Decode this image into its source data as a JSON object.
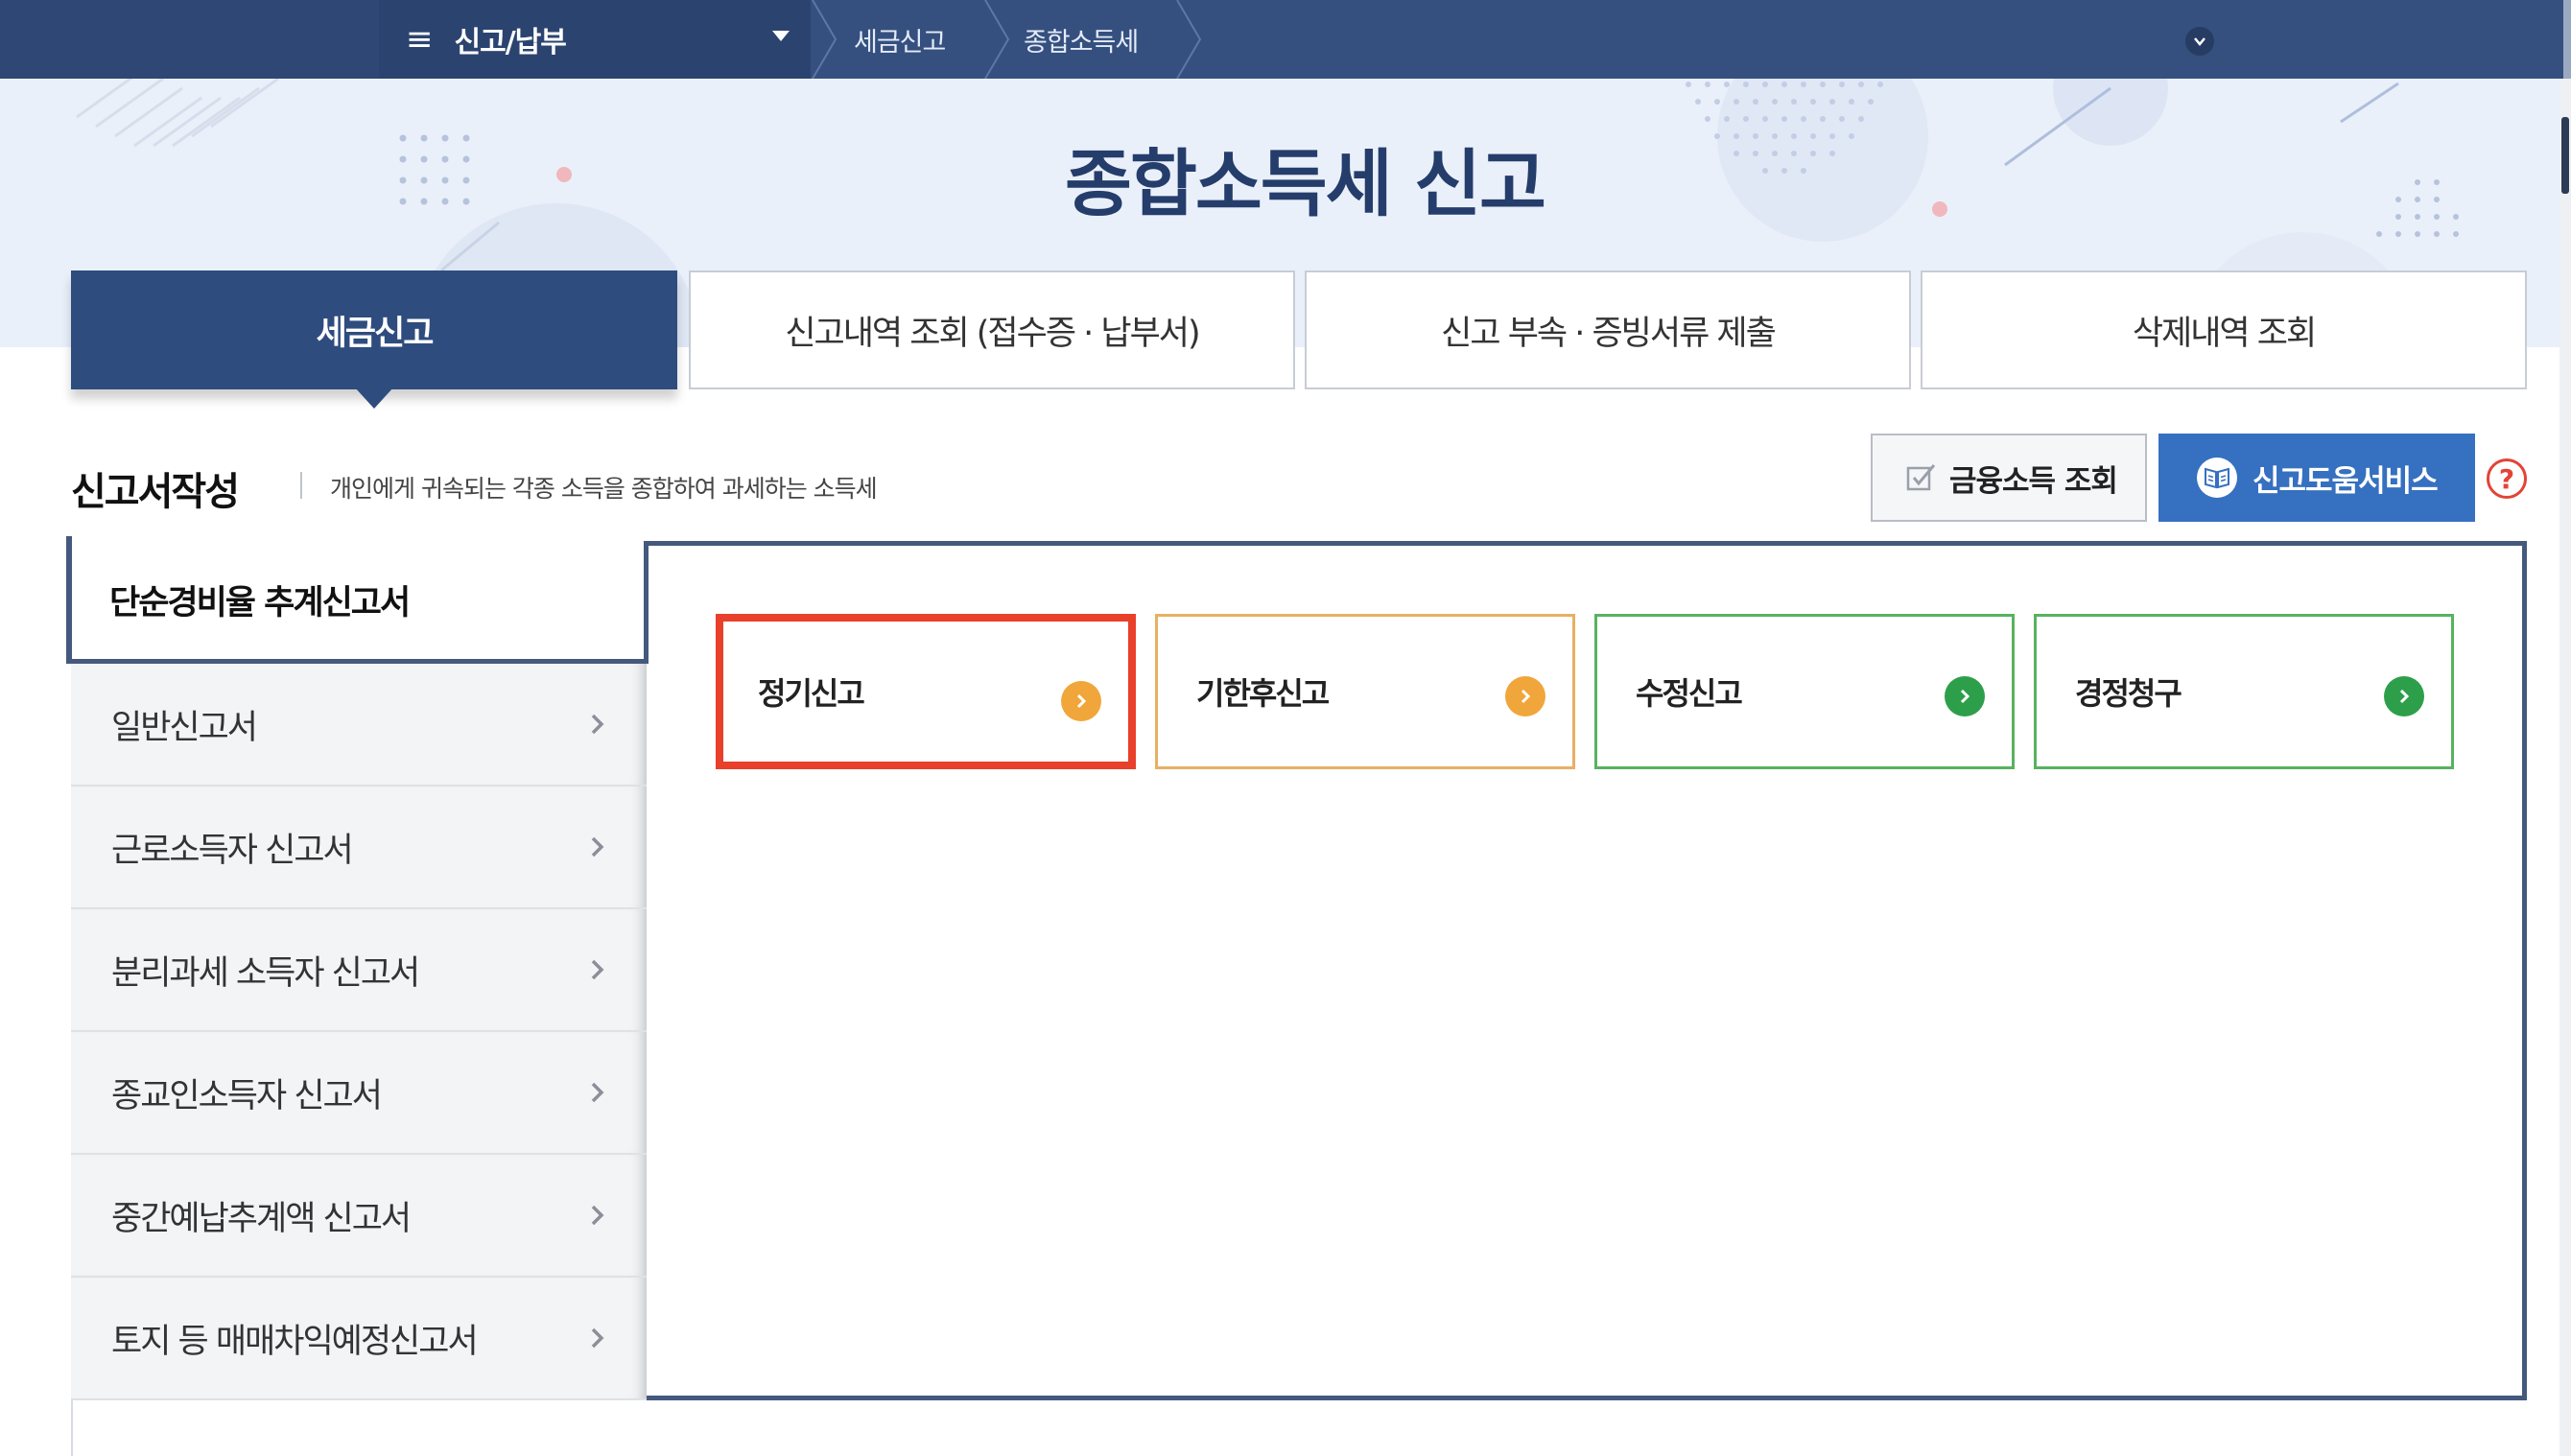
{
  "topnav": {
    "menu_label": "신고/납부",
    "breadcrumbs": [
      "세금신고",
      "종합소득세"
    ]
  },
  "hero": {
    "title": "종합소득세 신고"
  },
  "tabs": [
    {
      "label": "세금신고",
      "active": true
    },
    {
      "label": "신고내역 조회 (접수증 · 납부서)",
      "active": false
    },
    {
      "label": "신고 부속 · 증빙서류 제출",
      "active": false
    },
    {
      "label": "삭제내역 조회",
      "active": false
    }
  ],
  "section": {
    "title": "신고서작성",
    "description": "개인에게 귀속되는 각종 소득을 종합하여 과세하는 소득세",
    "finance_button": "금융소득 조회",
    "help_button": "신고도움서비스",
    "help_icon": "?"
  },
  "sidebar": {
    "active_item": "단순경비율 추계신고서",
    "items": [
      {
        "label": "일반신고서"
      },
      {
        "label": "근로소득자 신고서"
      },
      {
        "label": "분리과세 소득자 신고서"
      },
      {
        "label": "종교인소득자 신고서"
      },
      {
        "label": "중간예납추계액 신고서"
      },
      {
        "label": "토지 등 매매차익예정신고서"
      }
    ]
  },
  "cards": [
    {
      "label": "정기신고",
      "color": "orange",
      "selected": true
    },
    {
      "label": "기한후신고",
      "color": "orange",
      "selected": false
    },
    {
      "label": "수정신고",
      "color": "green",
      "selected": false
    },
    {
      "label": "경정청구",
      "color": "green",
      "selected": false
    }
  ],
  "colors": {
    "nav": "#35507f",
    "active_tab": "#2f4c7f",
    "panel_border": "#44597d",
    "help_button": "#3670c0",
    "selected_outline": "#e8402a",
    "orange_accent": "#f0a63a",
    "green_accent": "#2d9f4a"
  }
}
